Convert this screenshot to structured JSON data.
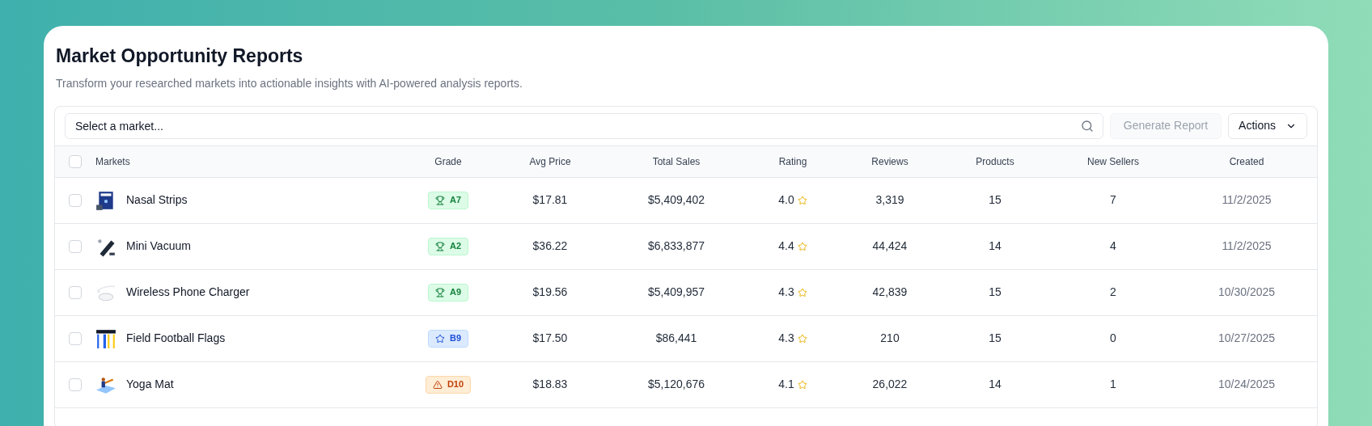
{
  "title": "Market Opportunity Reports",
  "subtitle": "Transform your researched markets into actionable insights with AI-powered analysis reports.",
  "search": {
    "placeholder": "Select a market..."
  },
  "generate_button": {
    "label": "Generate Report",
    "disabled": true
  },
  "actions_button": {
    "label": "Actions"
  },
  "table": {
    "select_all": {
      "checked": false
    },
    "columns": [
      "Markets",
      "Grade",
      "Avg Price",
      "Total Sales",
      "Rating",
      "Reviews",
      "Products",
      "New Sellers",
      "Created"
    ],
    "rows": [
      {
        "checked": false,
        "market": "Nasal Strips",
        "grade": {
          "label": "A7",
          "kind": "trophy"
        },
        "avg_price": "$17.81",
        "total_sales": "$5,409,402",
        "rating": "4.0",
        "reviews": "3,319",
        "products": "15",
        "new_sellers": "7",
        "created": "11/2/2025"
      },
      {
        "checked": false,
        "market": "Mini Vacuum",
        "grade": {
          "label": "A2",
          "kind": "trophy"
        },
        "avg_price": "$36.22",
        "total_sales": "$6,833,877",
        "rating": "4.4",
        "reviews": "44,424",
        "products": "14",
        "new_sellers": "4",
        "created": "11/2/2025"
      },
      {
        "checked": false,
        "market": "Wireless Phone Charger",
        "grade": {
          "label": "A9",
          "kind": "trophy"
        },
        "avg_price": "$19.56",
        "total_sales": "$5,409,957",
        "rating": "4.3",
        "reviews": "42,839",
        "products": "15",
        "new_sellers": "2",
        "created": "10/30/2025"
      },
      {
        "checked": false,
        "market": "Field Football Flags",
        "grade": {
          "label": "B9",
          "kind": "star"
        },
        "avg_price": "$17.50",
        "total_sales": "$86,441",
        "rating": "4.3",
        "reviews": "210",
        "products": "15",
        "new_sellers": "0",
        "created": "10/27/2025"
      },
      {
        "checked": false,
        "market": "Yoga Mat",
        "grade": {
          "label": "D10",
          "kind": "warning"
        },
        "avg_price": "$18.83",
        "total_sales": "$5,120,676",
        "rating": "4.1",
        "reviews": "26,022",
        "products": "14",
        "new_sellers": "1",
        "created": "10/24/2025"
      }
    ]
  }
}
